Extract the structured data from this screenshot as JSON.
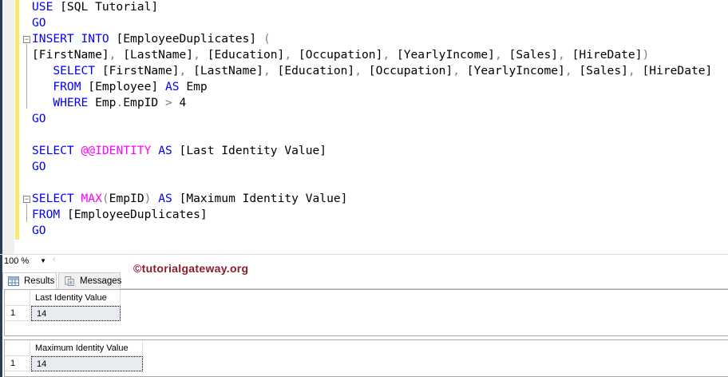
{
  "editor": {
    "lines": [
      [
        [
          "kw",
          "USE"
        ],
        [
          "id",
          " [SQL Tutorial]"
        ]
      ],
      [
        [
          "kw",
          "GO"
        ]
      ],
      [
        [
          "kw",
          "INSERT INTO"
        ],
        [
          "id",
          " [EmployeeDuplicates] "
        ],
        [
          "op",
          "("
        ]
      ],
      [
        [
          "id",
          "[FirstName]"
        ],
        [
          "op",
          ", "
        ],
        [
          "id",
          "[LastName]"
        ],
        [
          "op",
          ", "
        ],
        [
          "id",
          "[Education]"
        ],
        [
          "op",
          ", "
        ],
        [
          "id",
          "[Occupation]"
        ],
        [
          "op",
          ", "
        ],
        [
          "id",
          "[YearlyIncome]"
        ],
        [
          "op",
          ", "
        ],
        [
          "id",
          "[Sales]"
        ],
        [
          "op",
          ", "
        ],
        [
          "id",
          "[HireDate]"
        ],
        [
          "op",
          ")"
        ]
      ],
      [
        [
          "id",
          "   "
        ],
        [
          "kw",
          "SELECT"
        ],
        [
          "id",
          " [FirstName]"
        ],
        [
          "op",
          ", "
        ],
        [
          "id",
          "[LastName]"
        ],
        [
          "op",
          ", "
        ],
        [
          "id",
          "[Education]"
        ],
        [
          "op",
          ", "
        ],
        [
          "id",
          "[Occupation]"
        ],
        [
          "op",
          ", "
        ],
        [
          "id",
          "[YearlyIncome]"
        ],
        [
          "op",
          ", "
        ],
        [
          "id",
          "[Sales]"
        ],
        [
          "op",
          ", "
        ],
        [
          "id",
          "[HireDate]"
        ]
      ],
      [
        [
          "id",
          "   "
        ],
        [
          "kw",
          "FROM"
        ],
        [
          "id",
          " [Employee] "
        ],
        [
          "kw",
          "AS"
        ],
        [
          "id",
          " Emp"
        ]
      ],
      [
        [
          "id",
          "   "
        ],
        [
          "kw",
          "WHERE"
        ],
        [
          "id",
          " Emp"
        ],
        [
          "op",
          "."
        ],
        [
          "id",
          "EmpID "
        ],
        [
          "op",
          ">"
        ],
        [
          "id",
          " 4"
        ]
      ],
      [
        [
          "kw",
          "GO"
        ]
      ],
      [],
      [
        [
          "kw",
          "SELECT"
        ],
        [
          "id",
          " "
        ],
        [
          "fn",
          "@@IDENTITY"
        ],
        [
          "id",
          " "
        ],
        [
          "kw",
          "AS"
        ],
        [
          "id",
          " [Last Identity Value]"
        ]
      ],
      [
        [
          "kw",
          "GO"
        ]
      ],
      [],
      [
        [
          "kw",
          "SELECT"
        ],
        [
          "id",
          " "
        ],
        [
          "fn",
          "MAX"
        ],
        [
          "op",
          "("
        ],
        [
          "id",
          "EmpID"
        ],
        [
          "op",
          ")"
        ],
        [
          "id",
          " "
        ],
        [
          "kw",
          "AS"
        ],
        [
          "id",
          " [Maximum Identity Value]"
        ]
      ],
      [
        [
          "kw",
          "FROM"
        ],
        [
          "id",
          " [EmployeeDuplicates]"
        ]
      ],
      [
        [
          "kw",
          "GO"
        ]
      ]
    ]
  },
  "zoom_level": "100 %",
  "watermark": "©tutorialgateway.org",
  "tabs": [
    {
      "label": "Results",
      "icon": "grid-icon"
    },
    {
      "label": "Messages",
      "icon": "messages-icon"
    }
  ],
  "results": [
    {
      "column": "Last Identity Value",
      "row_number": "1",
      "value": "14"
    },
    {
      "column": "Maximum Identity Value",
      "row_number": "1",
      "value": "14"
    }
  ]
}
